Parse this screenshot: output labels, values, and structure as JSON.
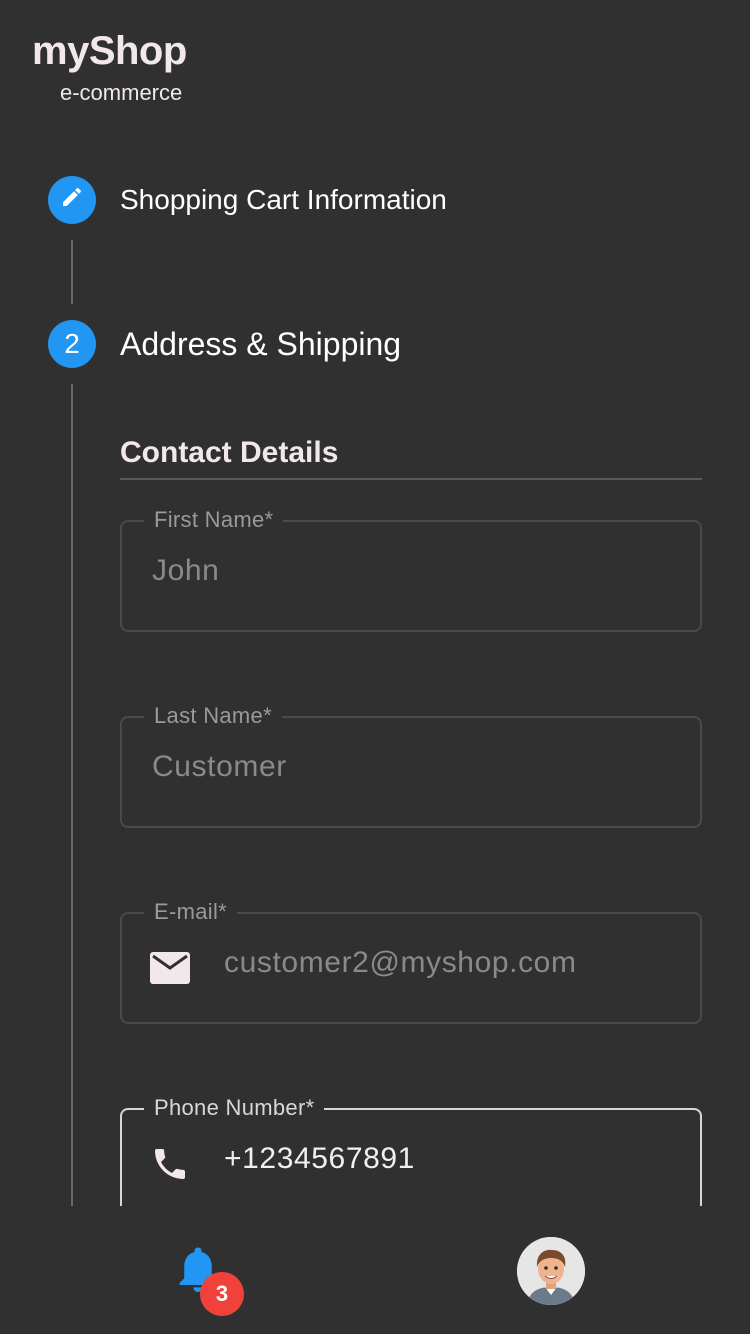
{
  "brand": {
    "title": "myShop",
    "subtitle": "e-commerce"
  },
  "steps": [
    {
      "icon": "pencil-icon",
      "label": "Shopping Cart Information",
      "state": "completed"
    },
    {
      "number": "2",
      "label": "Address & Shipping",
      "state": "active"
    }
  ],
  "section": {
    "heading": "Contact Details"
  },
  "fields": {
    "first_name": {
      "label": "First Name*",
      "value": "John"
    },
    "last_name": {
      "label": "Last Name*",
      "value": "Customer"
    },
    "email": {
      "label": "E-mail*",
      "value": "customer2@myshop.com",
      "icon": "mail-icon"
    },
    "phone": {
      "label": "Phone Number*",
      "value": "+1234567891",
      "icon": "phone-icon"
    }
  },
  "bottom_nav": {
    "notifications": {
      "icon": "bell-icon",
      "count": "3"
    },
    "profile": {
      "icon": "avatar"
    }
  },
  "colors": {
    "background": "#303030",
    "accent": "#2196f3",
    "badge": "#f0423a"
  }
}
